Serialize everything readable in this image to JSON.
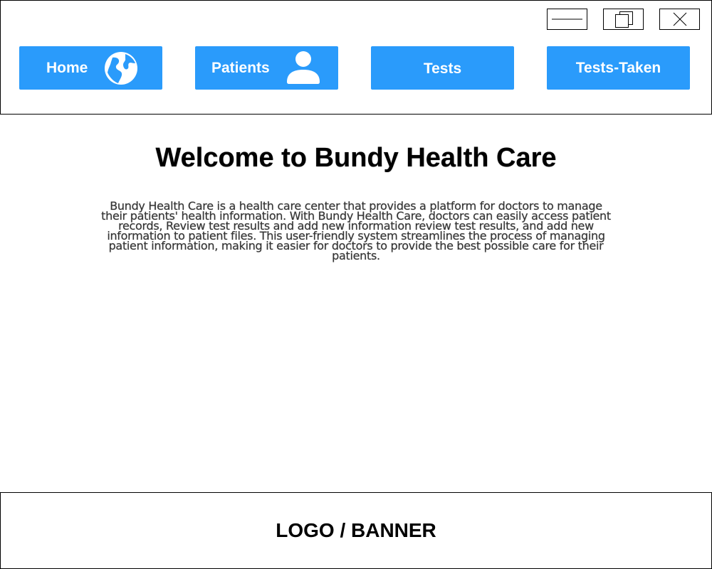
{
  "window": {
    "controls": {
      "minimize_icon": "minimize-icon",
      "maximize_icon": "restore-icon",
      "close_icon": "close-icon"
    }
  },
  "nav": {
    "accent_color": "#2a9bfb",
    "items": [
      {
        "label": "Home",
        "icon": "globe-icon"
      },
      {
        "label": "Patients",
        "icon": "user-icon"
      },
      {
        "label": "Tests",
        "icon": ""
      },
      {
        "label": "Tests-Taken",
        "icon": ""
      }
    ]
  },
  "main": {
    "title": "Welcome to Bundy Health Care",
    "intro": "Bundy Health Care is a health care center that provides a platform for doctors to manage their patients' health information. With Bundy Health Care, doctors can easily access patient records, Review test results and add new information review test results, and add new information to patient files. This user-friendly system streamlines the process of managing patient information, making it easier for doctors to provide the best possible care for their patients."
  },
  "footer": {
    "banner": "LOGO / BANNER"
  }
}
